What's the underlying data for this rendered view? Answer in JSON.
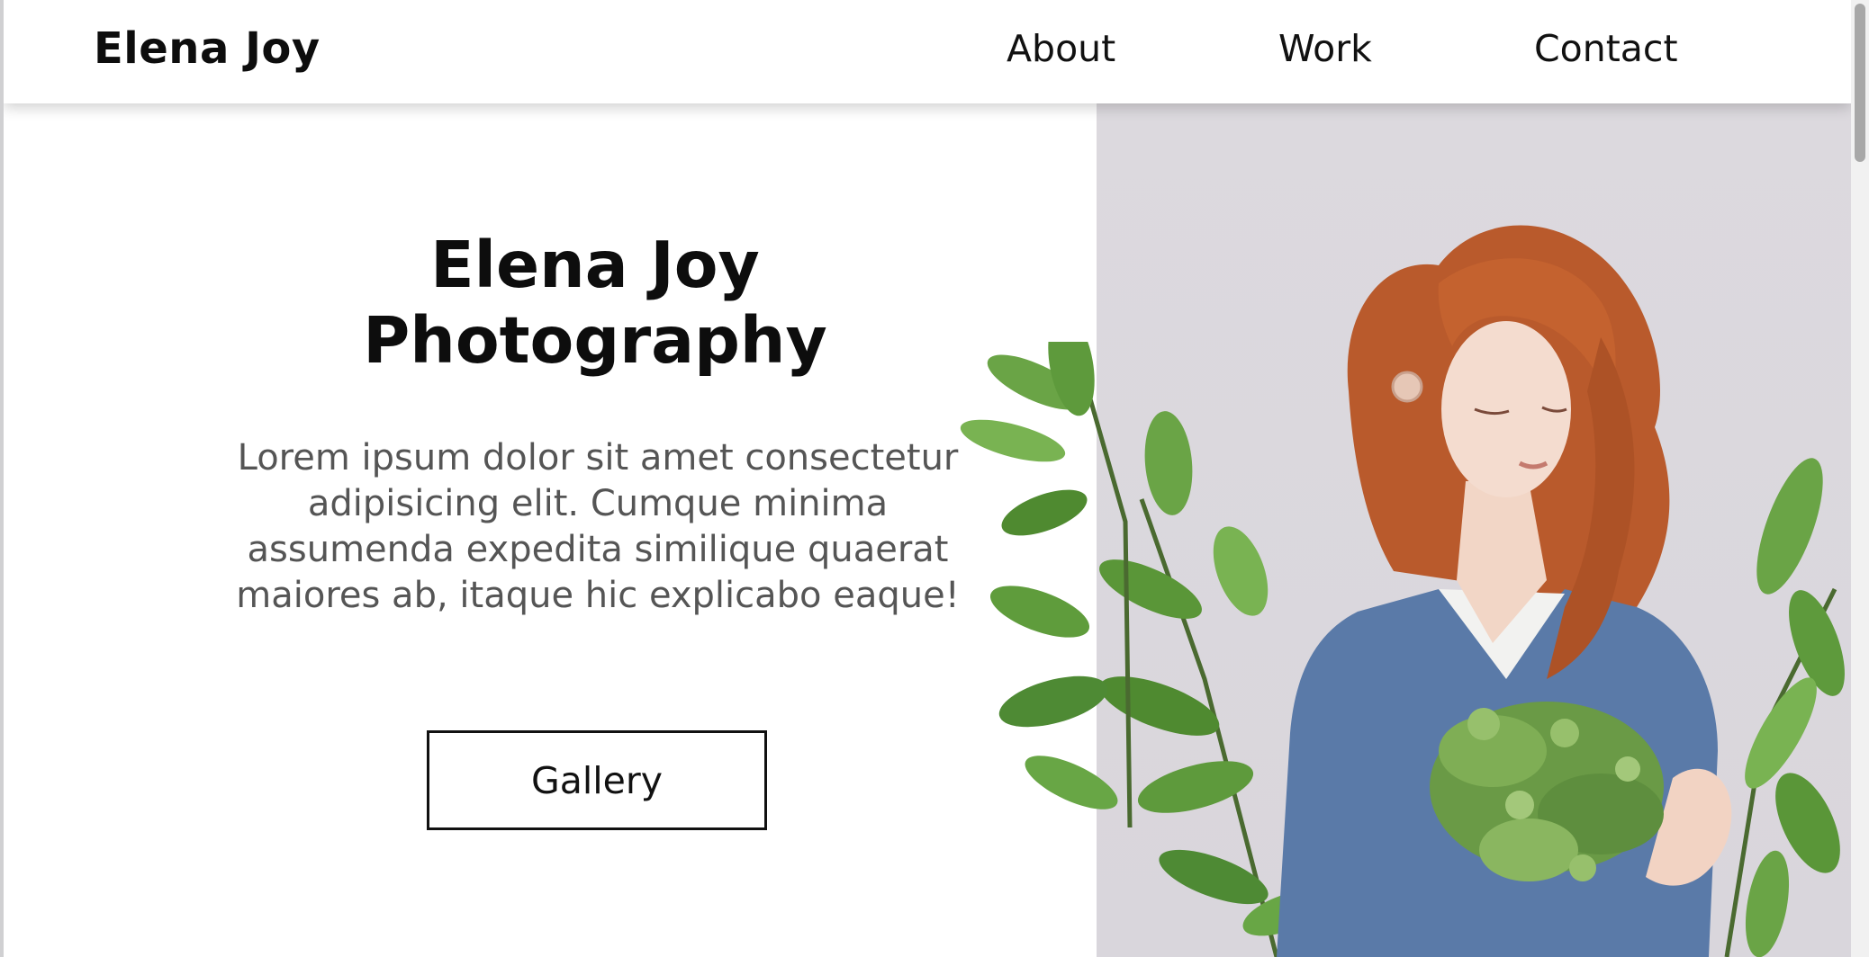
{
  "navbar": {
    "brand": "Elena Joy",
    "links": [
      {
        "label": "About"
      },
      {
        "label": "Work"
      },
      {
        "label": "Contact"
      }
    ]
  },
  "hero": {
    "title_line1": "Elena Joy",
    "title_line2": "Photography",
    "description": "Lorem ipsum dolor sit amet consectetur adipisicing elit. Cumque minima assumenda expedita similique quaerat maiores ab, itaque hic explicabo eaque!",
    "button_label": "Gallery"
  },
  "colors": {
    "text": "#0d0d0d",
    "muted_text": "#555555",
    "photo_background": "#dcd9de",
    "sweater": "#5a7aa8",
    "hair": "#b95a2c",
    "leaf": "#5e9a3c"
  }
}
